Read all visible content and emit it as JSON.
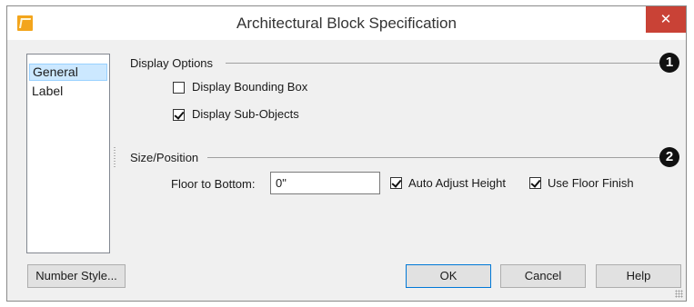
{
  "window": {
    "title": "Architectural Block Specification",
    "close_glyph": "✕",
    "icon": "app-icon"
  },
  "sidebar": {
    "items": [
      {
        "label": "General",
        "selected": true
      },
      {
        "label": "Label",
        "selected": false
      }
    ]
  },
  "display_options": {
    "heading": "Display Options",
    "badge": "1",
    "display_bounding_box": {
      "label": "Display Bounding Box",
      "checked": false
    },
    "display_sub_objects": {
      "label": "Display Sub-Objects",
      "checked": true
    }
  },
  "size_position": {
    "heading": "Size/Position",
    "badge": "2",
    "floor_to_bottom": {
      "label": "Floor to Bottom:",
      "value": "0\""
    },
    "auto_adjust_height": {
      "label": "Auto Adjust Height",
      "checked": true
    },
    "use_floor_finish": {
      "label": "Use Floor Finish",
      "checked": true
    }
  },
  "buttons": {
    "number_style": "Number Style...",
    "ok": "OK",
    "cancel": "Cancel",
    "help": "Help"
  },
  "colors": {
    "accent": "#0078d7",
    "close": "#c94236",
    "selection": "#cce8ff"
  }
}
